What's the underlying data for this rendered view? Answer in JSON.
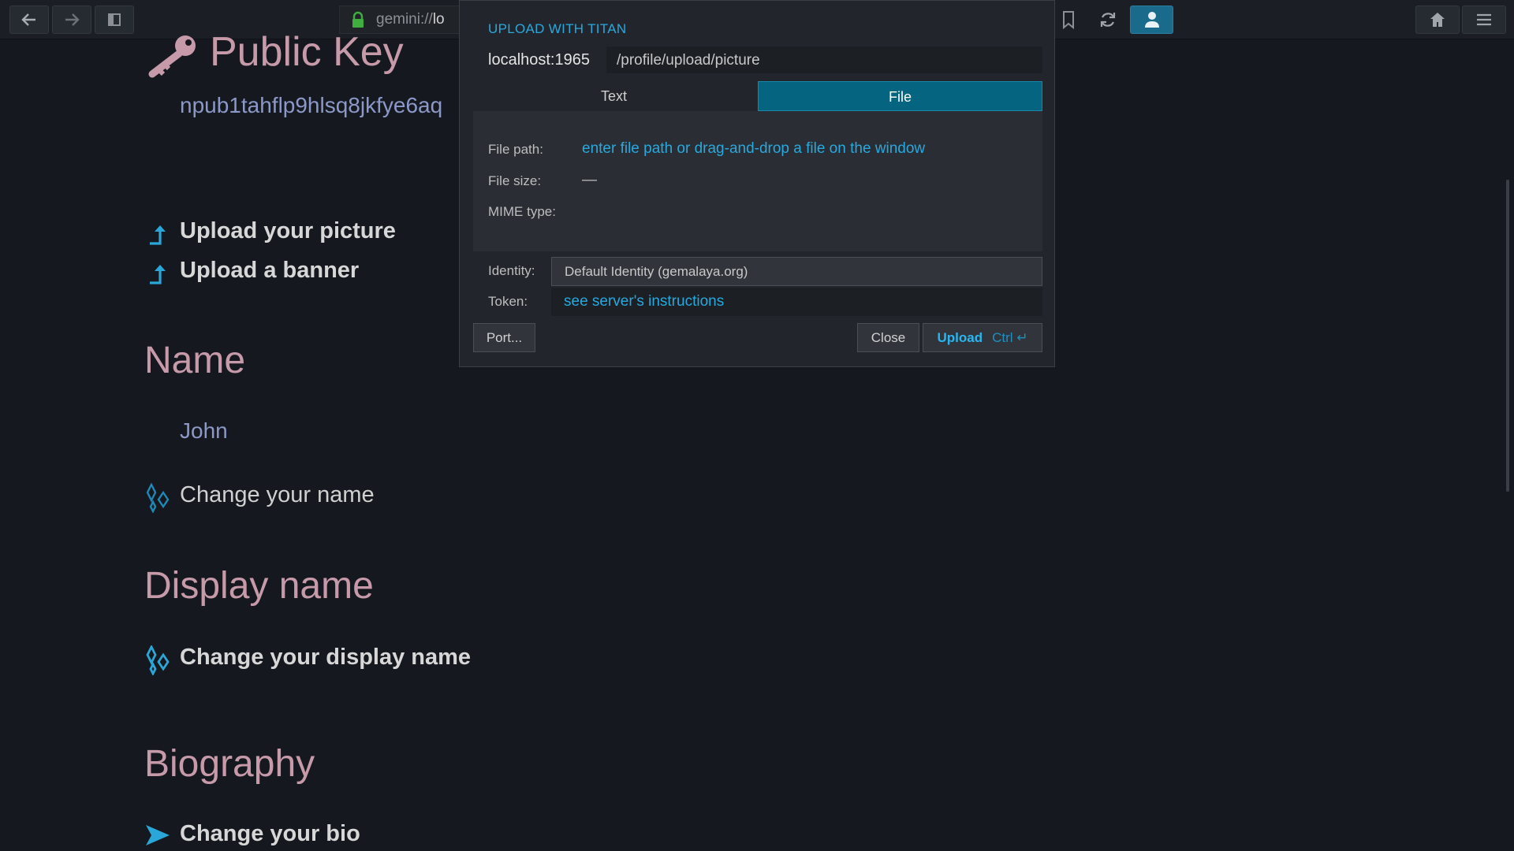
{
  "toolbar": {
    "url_prefix": "gemini://",
    "url_rest": "lo",
    "back_icon": "arrow-left-icon",
    "forward_icon": "arrow-right-icon",
    "sidebar_icon": "sidebar-toggle-icon",
    "lock_icon": "lock-icon",
    "bookmark_icon": "bookmark-icon",
    "reload_icon": "reload-icon",
    "identity_icon": "person-icon",
    "home_icon": "home-icon",
    "menu_icon": "hamburger-menu-icon"
  },
  "page": {
    "public_key_heading": "Public Key",
    "public_key_value": "npub1tahflp9hlsq8jkfye6aq",
    "upload_picture": "Upload your picture",
    "upload_banner": "Upload a banner",
    "name_heading": "Name",
    "name_value": "John",
    "change_name": "Change your name",
    "display_name_heading": "Display name",
    "change_display_name": "Change your display name",
    "biography_heading": "Biography",
    "change_bio": "Change your bio"
  },
  "dialog": {
    "title": "UPLOAD WITH TITAN",
    "host": "localhost:1965",
    "path": "/profile/upload/picture",
    "tabs": [
      "Text",
      "File"
    ],
    "active_tab": "File",
    "file_path_label": "File path:",
    "file_path_placeholder": "enter file path or drag-and-drop a file on the window",
    "file_size_label": "File size:",
    "file_size_value": "—",
    "mime_label": "MIME type:",
    "identity_label": "Identity:",
    "identity_value": "Default Identity (gemalaya.org)",
    "token_label": "Token:",
    "token_placeholder": "see server's instructions",
    "port_button": "Port...",
    "close_button": "Close",
    "upload_button": "Upload",
    "upload_shortcut": "Ctrl ↵"
  },
  "colors": {
    "accent": "#29a8dd",
    "active_tab": "#05647f",
    "heading": "#c79aa9",
    "link_icon": "#2aa7d8",
    "background": "#15191f"
  }
}
